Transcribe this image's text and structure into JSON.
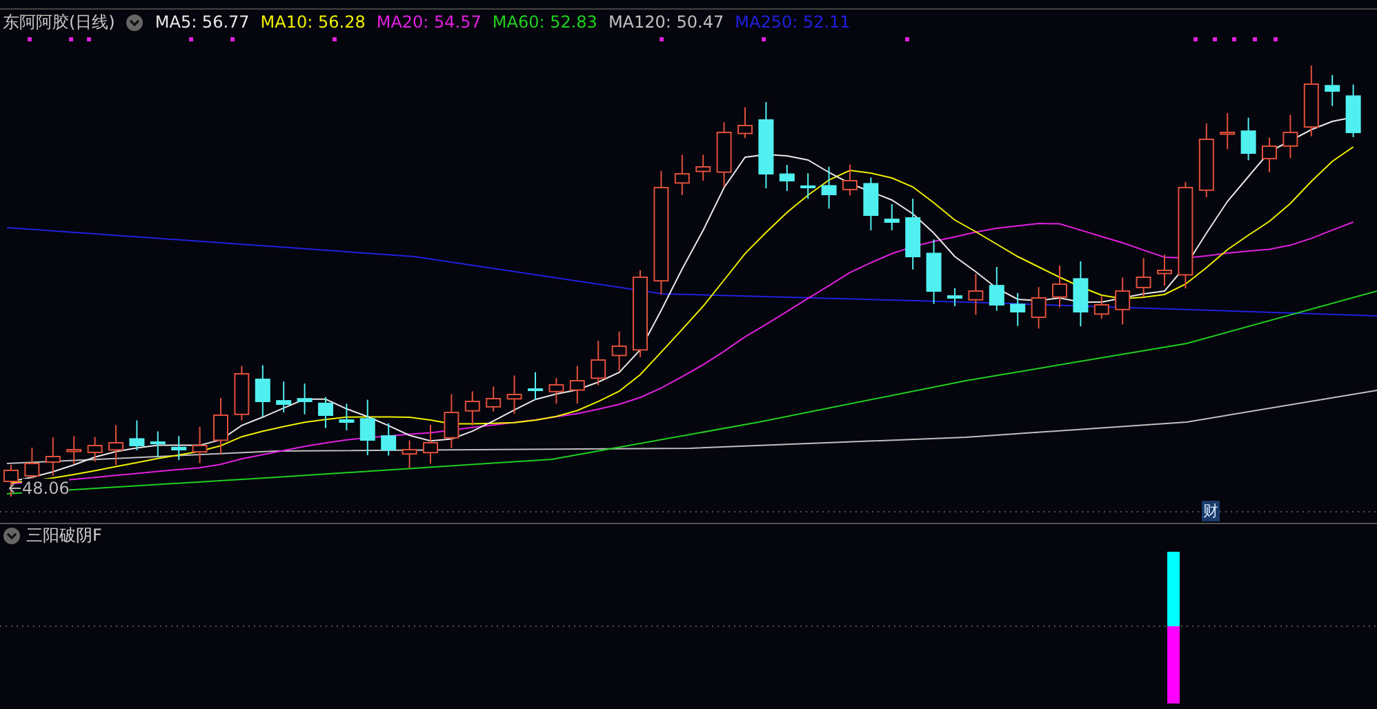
{
  "stock": {
    "title": "东阿阿胶(日线)"
  },
  "ma_legend": [
    {
      "label": "MA5: 56.77",
      "color": "#e8e8e8"
    },
    {
      "label": "MA10: 56.28",
      "color": "#f0f000"
    },
    {
      "label": "MA20: 54.57",
      "color": "#e020e0"
    },
    {
      "label": "MA60: 52.83",
      "color": "#20d020"
    },
    {
      "label": "MA120: 50.47",
      "color": "#c0c0c0"
    },
    {
      "label": "MA250: 52.11",
      "color": "#2020e0"
    }
  ],
  "price_label": "48.06",
  "event_marker": "财",
  "indicator": {
    "title": "三阳破阴F"
  }
}
